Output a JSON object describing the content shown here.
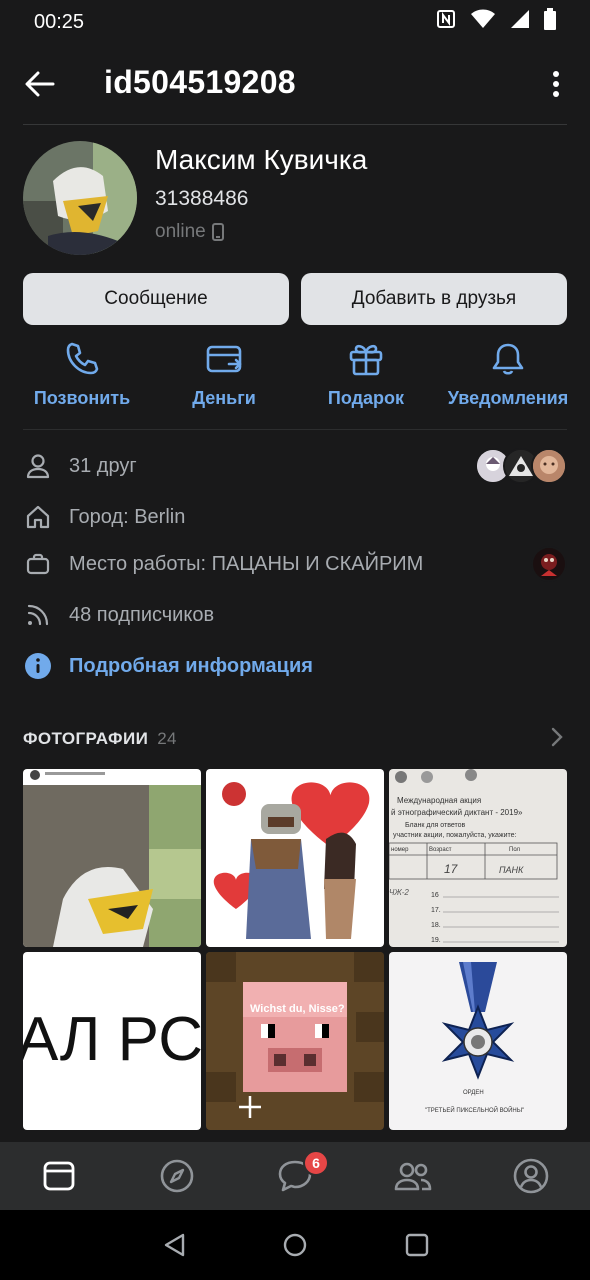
{
  "status": {
    "time": "00:25"
  },
  "header": {
    "title": "id504519208"
  },
  "profile": {
    "name": "Максим Кувичка",
    "status_text": "31388486",
    "online": "online"
  },
  "buttons": {
    "message": "Сообщение",
    "add_friend": "Добавить в друзья"
  },
  "actions": [
    {
      "label": "Позвонить",
      "icon": "phone-icon"
    },
    {
      "label": "Деньги",
      "icon": "money-icon"
    },
    {
      "label": "Подарок",
      "icon": "gift-icon"
    },
    {
      "label": "Уведомления",
      "icon": "bell-icon"
    }
  ],
  "info": {
    "friends": "31 друг",
    "city": "Город: Berlin",
    "work": "Место работы: ПАЦАНЫ И СКАЙРИМ",
    "followers": "48 подписчиков",
    "details": "Подробная информация"
  },
  "photos": {
    "title": "ФОТОГРАФИИ",
    "count": "24",
    "tile2_caption": "Wichst du, Nisse?",
    "tile0_text": "АЛ РС",
    "tile3_title": "Международная акция",
    "tile3_subtitle": "й этнографический диктант - 2019»",
    "tile3_form": "Бланк для ответов",
    "tile3_prompt": "участник акции, пожалуйста, укажите:",
    "tile3_col1": "номер",
    "tile3_col2": "Возраст",
    "tile3_col3": "Пол",
    "tile3_val1": "17",
    "tile3_val2": "ПАНК",
    "tile3_val3": "ЧЖ-2",
    "tile3_row_a": "16",
    "tile3_row_b": "17.",
    "tile3_row_c": "18.",
    "tile3_row_d": "19.",
    "tile5_label1": "ОРДЕН",
    "tile5_label2": "\"ТРЕТЬЕЙ ПИКСЕЛЬНОЙ ВОЙНЫ\""
  },
  "nav": {
    "messages_badge": "6"
  },
  "colors": {
    "accent": "#71aaeb",
    "background": "#19191a",
    "badge": "#e64646"
  }
}
